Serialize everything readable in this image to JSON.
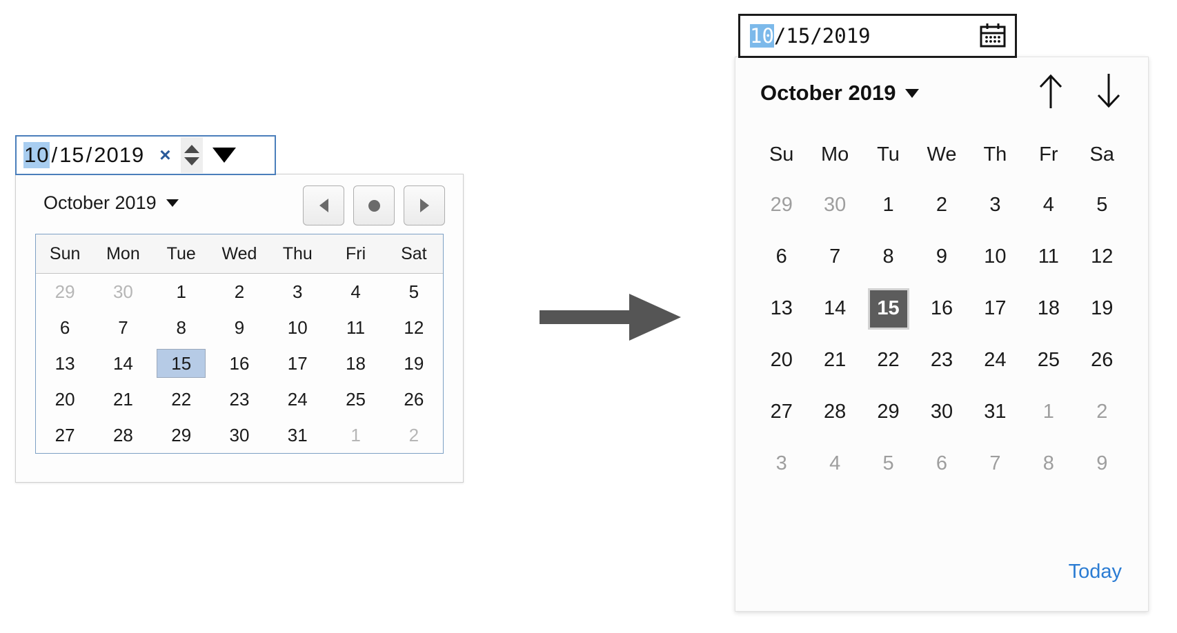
{
  "left_widget": {
    "input": {
      "name": "date-input",
      "segments": {
        "month": "10",
        "day": "15",
        "year": "2019"
      },
      "separator": "/",
      "highlighted_segment": "month",
      "clear_label": "×",
      "spinner_name": "spin-buttons",
      "dropdown_name": "dropdown-triangle"
    },
    "panel": {
      "month_label": "October 2019",
      "nav": {
        "prev": "previous-month",
        "today": "today-dot",
        "next": "next-month"
      },
      "weekdays": [
        "Sun",
        "Mon",
        "Tue",
        "Wed",
        "Thu",
        "Fri",
        "Sat"
      ],
      "weeks": [
        [
          {
            "d": "29",
            "m": true
          },
          {
            "d": "30",
            "m": true
          },
          {
            "d": "1"
          },
          {
            "d": "2"
          },
          {
            "d": "3"
          },
          {
            "d": "4"
          },
          {
            "d": "5"
          }
        ],
        [
          {
            "d": "6"
          },
          {
            "d": "7"
          },
          {
            "d": "8"
          },
          {
            "d": "9"
          },
          {
            "d": "10"
          },
          {
            "d": "11"
          },
          {
            "d": "12"
          }
        ],
        [
          {
            "d": "13"
          },
          {
            "d": "14"
          },
          {
            "d": "15",
            "s": true
          },
          {
            "d": "16"
          },
          {
            "d": "17"
          },
          {
            "d": "18"
          },
          {
            "d": "19"
          }
        ],
        [
          {
            "d": "20"
          },
          {
            "d": "21"
          },
          {
            "d": "22"
          },
          {
            "d": "23"
          },
          {
            "d": "24"
          },
          {
            "d": "25"
          },
          {
            "d": "26"
          }
        ],
        [
          {
            "d": "27"
          },
          {
            "d": "28"
          },
          {
            "d": "29"
          },
          {
            "d": "30"
          },
          {
            "d": "31"
          },
          {
            "d": "1",
            "m": true
          },
          {
            "d": "2",
            "m": true
          }
        ]
      ],
      "selected_day": "15",
      "colors": {
        "selected_bg": "#b6cbe6",
        "border": "#7da0c4",
        "header_bg": "#f6f6f6"
      }
    }
  },
  "arrow": {
    "name": "flow-arrow",
    "direction": "right",
    "color": "#555555"
  },
  "right_widget": {
    "input": {
      "name": "date-input",
      "segments": {
        "month": "10",
        "day": "15",
        "year": "2019"
      },
      "separator": "/",
      "highlighted_segment": "month",
      "icon": "calendar-icon"
    },
    "panel": {
      "month_label": "October 2019",
      "nav": {
        "prev": "up-arrow",
        "next": "down-arrow"
      },
      "weekdays": [
        "Su",
        "Mo",
        "Tu",
        "We",
        "Th",
        "Fr",
        "Sa"
      ],
      "weeks": [
        [
          {
            "d": "29",
            "m": true
          },
          {
            "d": "30",
            "m": true
          },
          {
            "d": "1"
          },
          {
            "d": "2"
          },
          {
            "d": "3"
          },
          {
            "d": "4"
          },
          {
            "d": "5"
          }
        ],
        [
          {
            "d": "6"
          },
          {
            "d": "7"
          },
          {
            "d": "8"
          },
          {
            "d": "9"
          },
          {
            "d": "10"
          },
          {
            "d": "11"
          },
          {
            "d": "12"
          }
        ],
        [
          {
            "d": "13"
          },
          {
            "d": "14"
          },
          {
            "d": "15",
            "s": true
          },
          {
            "d": "16"
          },
          {
            "d": "17"
          },
          {
            "d": "18"
          },
          {
            "d": "19"
          }
        ],
        [
          {
            "d": "20"
          },
          {
            "d": "21"
          },
          {
            "d": "22"
          },
          {
            "d": "23"
          },
          {
            "d": "24"
          },
          {
            "d": "25"
          },
          {
            "d": "26"
          }
        ],
        [
          {
            "d": "27"
          },
          {
            "d": "28"
          },
          {
            "d": "29"
          },
          {
            "d": "30"
          },
          {
            "d": "31"
          },
          {
            "d": "1",
            "m": true
          },
          {
            "d": "2",
            "m": true
          }
        ],
        [
          {
            "d": "3",
            "m": true
          },
          {
            "d": "4",
            "m": true
          },
          {
            "d": "5",
            "m": true
          },
          {
            "d": "6",
            "m": true
          },
          {
            "d": "7",
            "m": true
          },
          {
            "d": "8",
            "m": true
          },
          {
            "d": "9",
            "m": true
          }
        ]
      ],
      "selected_day": "15",
      "today_label": "Today",
      "colors": {
        "selected_bg": "#5c5c5c",
        "selected_fg": "#ffffff",
        "link": "#2b7cd3",
        "highlight": "#7cb9ea"
      }
    }
  }
}
